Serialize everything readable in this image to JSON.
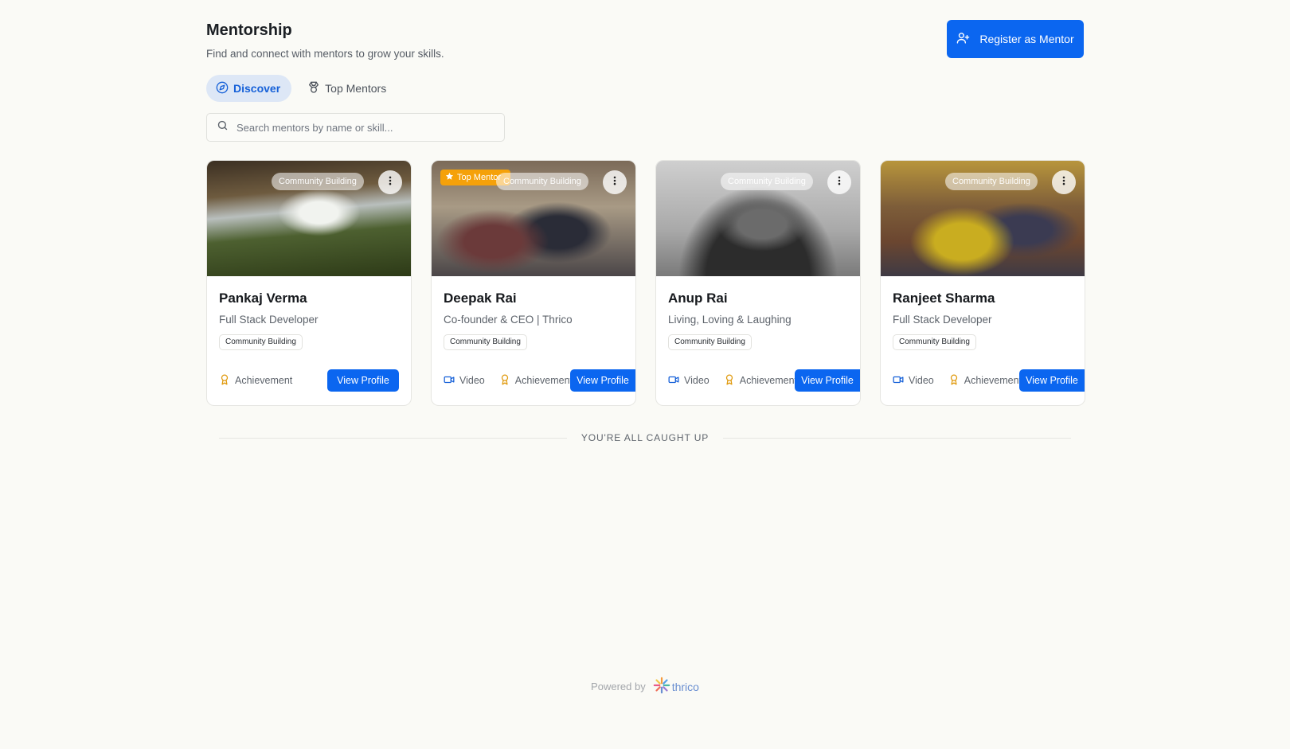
{
  "header": {
    "title": "Mentorship",
    "subtitle": "Find and connect with mentors to grow your skills.",
    "register_label": "Register as Mentor"
  },
  "tabs": [
    {
      "label": "Discover",
      "icon": "compass-icon",
      "active": true
    },
    {
      "label": "Top Mentors",
      "icon": "medal-icon",
      "active": false
    }
  ],
  "search": {
    "placeholder": "Search mentors by name or skill...",
    "value": ""
  },
  "mentors": [
    {
      "name": "Pankaj Verma",
      "role": "Full Stack Developer",
      "skill": "Community Building",
      "image_badge": "Community Building",
      "top_mentor": false,
      "features": [
        "Achievement"
      ],
      "view_label": "View Profile"
    },
    {
      "name": "Deepak Rai",
      "role": "Co-founder & CEO | Thrico",
      "skill": "Community Building",
      "image_badge": "Community Building",
      "top_mentor": true,
      "top_badge_label": "Top Mentor",
      "features": [
        "Video",
        "Achievement"
      ],
      "view_label": "View Profile"
    },
    {
      "name": "Anup Rai",
      "role": "Living, Loving & Laughing",
      "skill": "Community Building",
      "image_badge": "Community Building",
      "top_mentor": false,
      "features": [
        "Video",
        "Achievement"
      ],
      "view_label": "View Profile"
    },
    {
      "name": "Ranjeet Sharma",
      "role": "Full Stack Developer",
      "skill": "Community Building",
      "image_badge": "Community Building",
      "top_mentor": false,
      "features": [
        "Video",
        "Achievement"
      ],
      "view_label": "View Profile"
    }
  ],
  "status": {
    "caught_up": "YOU'RE ALL CAUGHT UP"
  },
  "footer": {
    "powered_by": "Powered by",
    "brand": "thrico"
  },
  "colors": {
    "accent": "#0b66f0",
    "top_mentor_badge": "#f5a10a",
    "background": "#fafaf6"
  }
}
